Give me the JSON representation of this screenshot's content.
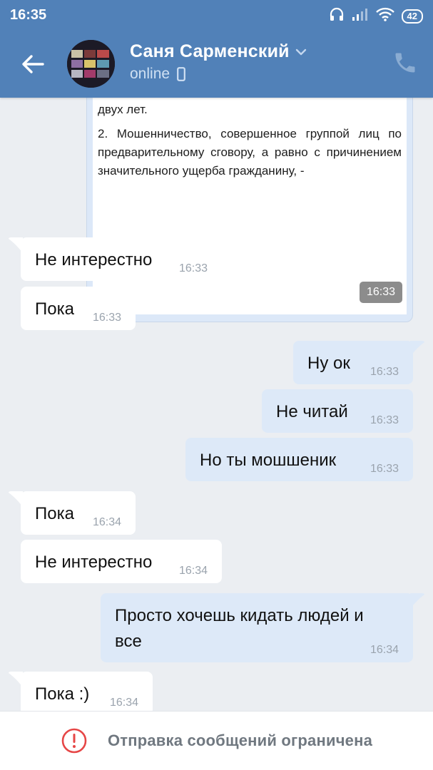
{
  "status_bar": {
    "time": "16:35",
    "battery": "42"
  },
  "header": {
    "name": "Саня Сарменский",
    "status": "online"
  },
  "forwarded": {
    "line1": "двух лет.",
    "paragraph": "2. Мошенничество, совершенное группой лиц по предварительному сговору, а равно с причинением значительного ущерба гражданину, -",
    "time": "16:33"
  },
  "messages": [
    {
      "dir": "in",
      "text": "Не интерестно",
      "time": "16:33"
    },
    {
      "dir": "in",
      "text": "Пока",
      "time": "16:33"
    },
    {
      "dir": "out",
      "text": "Ну ок",
      "time": "16:33"
    },
    {
      "dir": "out",
      "text": "Не читай",
      "time": "16:33"
    },
    {
      "dir": "out",
      "text": "Но ты мошшеник",
      "time": "16:33"
    },
    {
      "dir": "in",
      "text": "Пока",
      "time": "16:34"
    },
    {
      "dir": "in",
      "text": "Не интерестно",
      "time": "16:34"
    },
    {
      "dir": "out",
      "text": "Просто хочешь кидать людей и\nвсе",
      "time": "16:34"
    },
    {
      "dir": "in",
      "text": "Пока :)",
      "time": "16:34"
    }
  ],
  "bottom_bar": {
    "text": "Отправка сообщений ограничена"
  },
  "colors": {
    "header": "#5181b8",
    "background": "#ebeef2",
    "incoming": "#ffffff",
    "outgoing": "#dde9f8",
    "alert": "#e64646"
  },
  "icons": [
    "back-arrow-icon",
    "chevron-down-icon",
    "phone-icon",
    "mobile-device-icon",
    "headphones-icon",
    "signal-icon",
    "wifi-icon",
    "battery-icon",
    "alert-circle-icon"
  ]
}
